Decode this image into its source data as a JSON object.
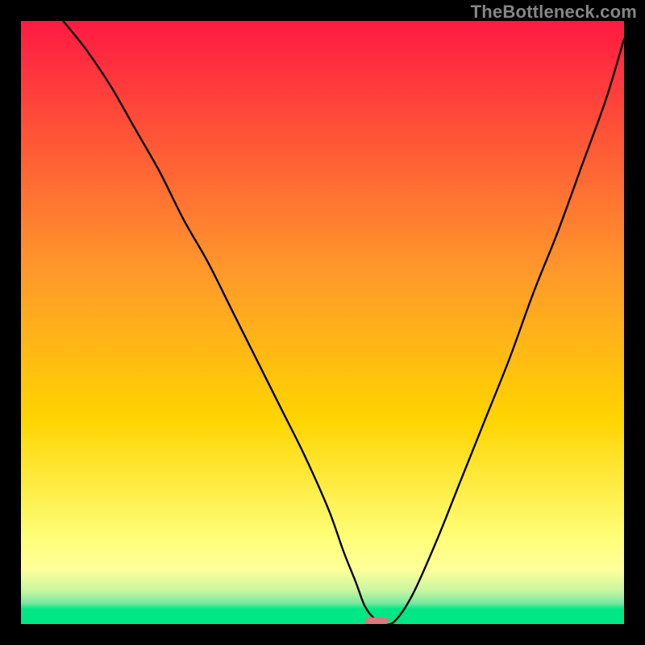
{
  "watermark": "TheBottleneck.com",
  "colors": {
    "frame": "#000000",
    "top": "#ff1a42",
    "mid": "#ffd400",
    "pale": "#feff9a",
    "greenLight": "#79e8a0",
    "greenBand": "#00e885",
    "curve": "#000000",
    "marker": "#d67a7a"
  },
  "chart_data": {
    "type": "line",
    "title": "",
    "xlabel": "",
    "ylabel": "",
    "xlim": [
      0,
      100
    ],
    "ylim": [
      0,
      100
    ],
    "grid": false,
    "series": [
      {
        "name": "bottleneck-curve",
        "x": [
          7,
          11,
          15,
          19,
          23,
          27,
          31,
          35,
          39,
          43,
          47,
          51,
          53.5,
          55.5,
          57,
          58.5,
          60,
          62,
          65,
          69,
          73,
          77,
          81,
          85,
          89,
          93,
          97,
          100
        ],
        "y": [
          100,
          95,
          89,
          82,
          75,
          67,
          60,
          52,
          44,
          36,
          28,
          19,
          12,
          7,
          3,
          1,
          0,
          0.5,
          5,
          14,
          24,
          34,
          44,
          55,
          65,
          76,
          87,
          97
        ]
      }
    ],
    "optimum_marker": {
      "x": 59,
      "y": 0.5,
      "width": 4,
      "height": 1.2
    }
  }
}
